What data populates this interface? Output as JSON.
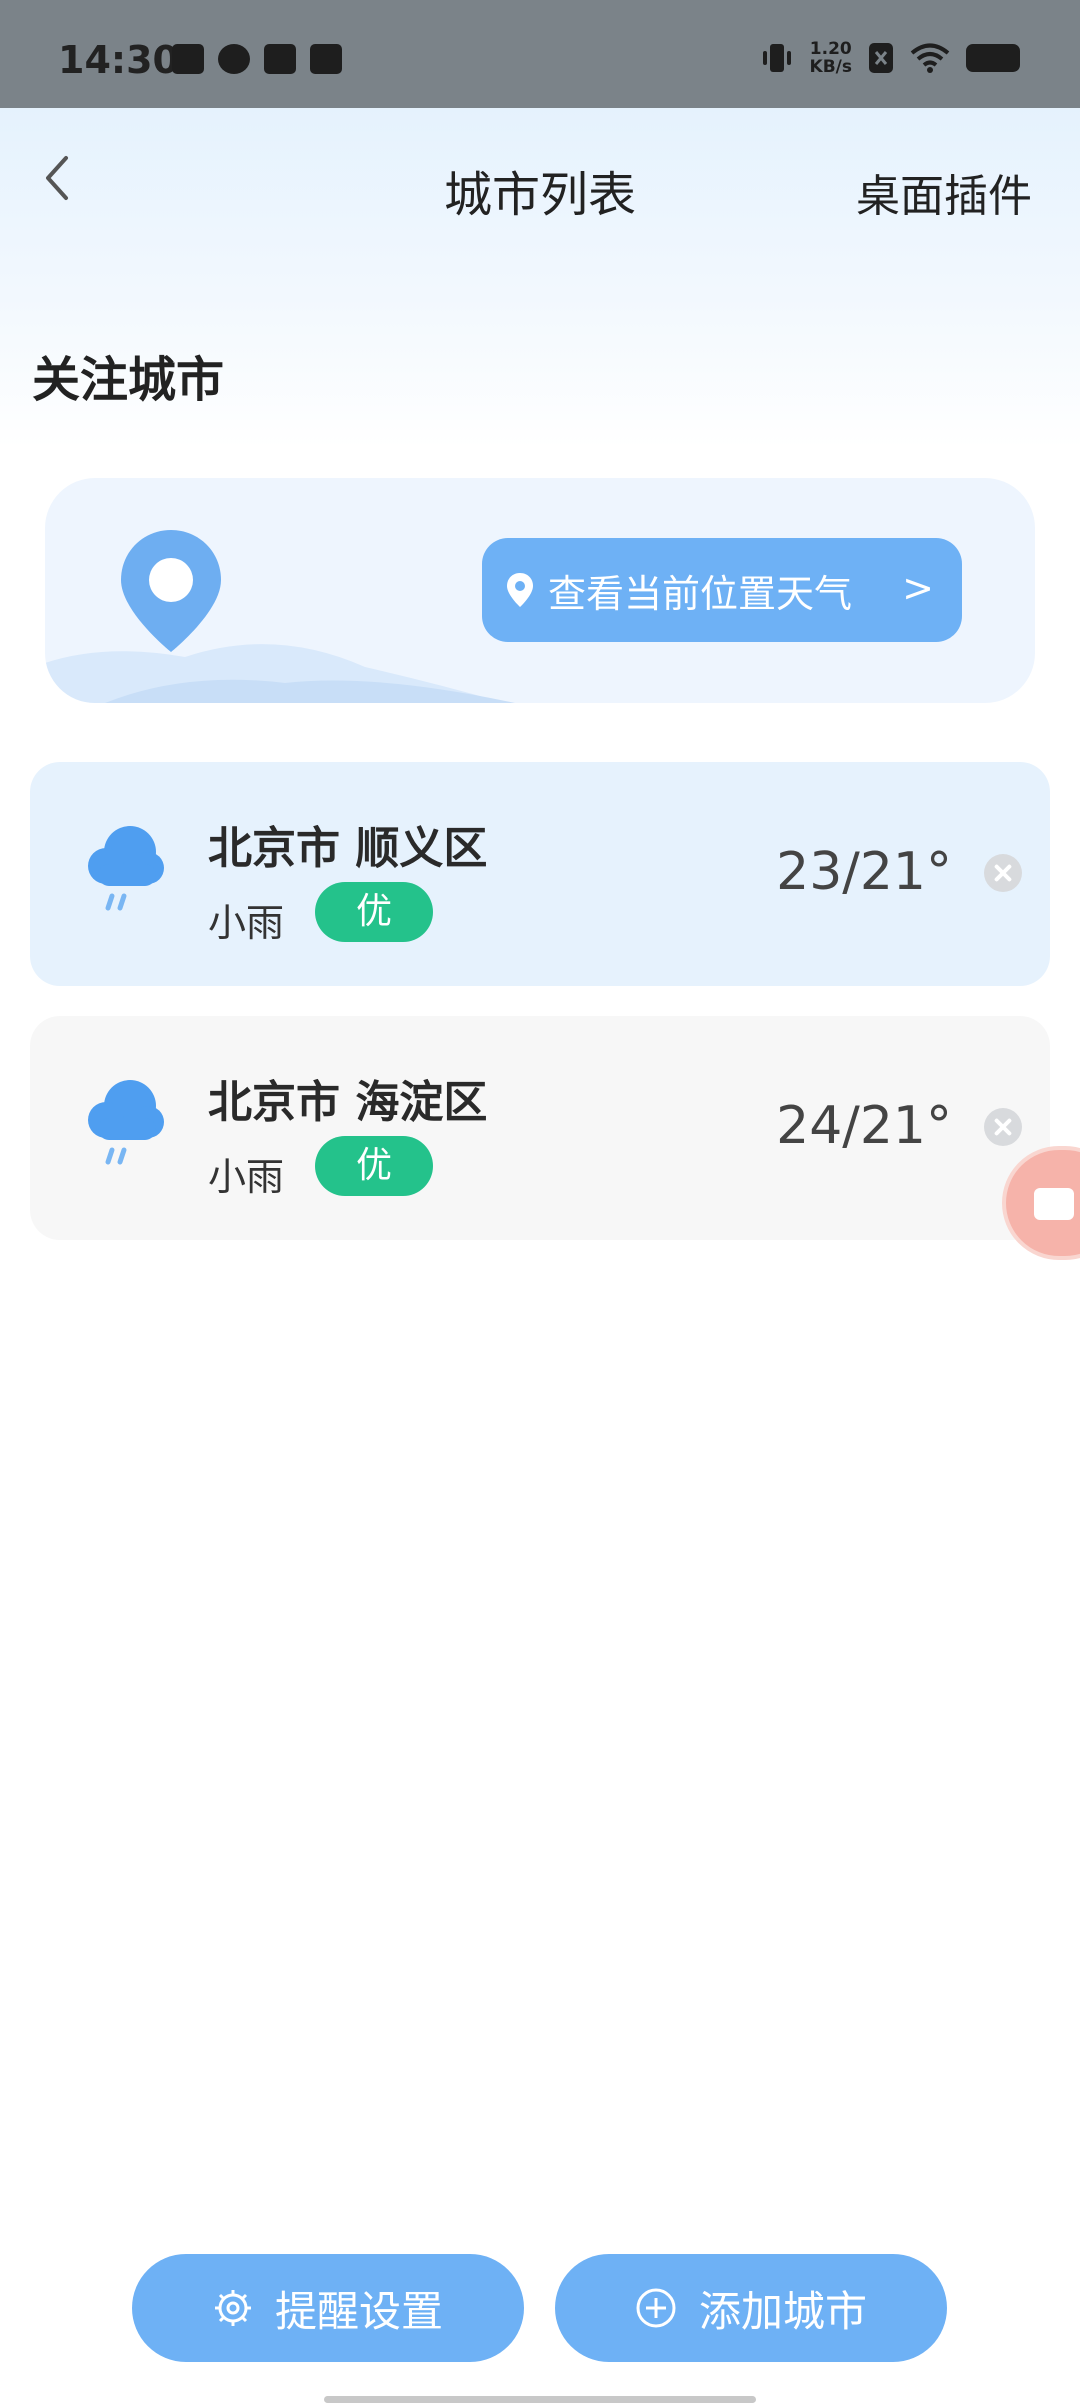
{
  "status_bar": {
    "time": "14:30",
    "net_speed_value": "1.20",
    "net_speed_unit": "KB/s",
    "left_icons": [
      "video-icon",
      "app-icon",
      "message-icon",
      "bag-icon"
    ],
    "right_icons": [
      "vibrate-icon",
      "net-speed",
      "sim-off-icon",
      "wifi-icon",
      "battery-icon"
    ]
  },
  "header": {
    "back_icon": "chevron-left-icon",
    "title": "城市列表",
    "widget_link": "桌面插件"
  },
  "section": {
    "title": "关注城市"
  },
  "location_card": {
    "button_label": "查看当前位置天气",
    "chevron": ">"
  },
  "cities": [
    {
      "name": "北京市 顺义区",
      "weather": "小雨",
      "aqi": "优",
      "temp": "23/21°",
      "icon": "rain-cloud-icon"
    },
    {
      "name": "北京市 海淀区",
      "weather": "小雨",
      "aqi": "优",
      "temp": "24/21°",
      "icon": "rain-cloud-icon"
    }
  ],
  "bottom_bar": {
    "reminder_label": "提醒设置",
    "add_city_label": "添加城市"
  },
  "colors": {
    "accent": "#6eb1f5",
    "aqi_good": "#24c28b",
    "card_highlight": "#e6f2fd",
    "card_normal": "#f7f7f7"
  }
}
